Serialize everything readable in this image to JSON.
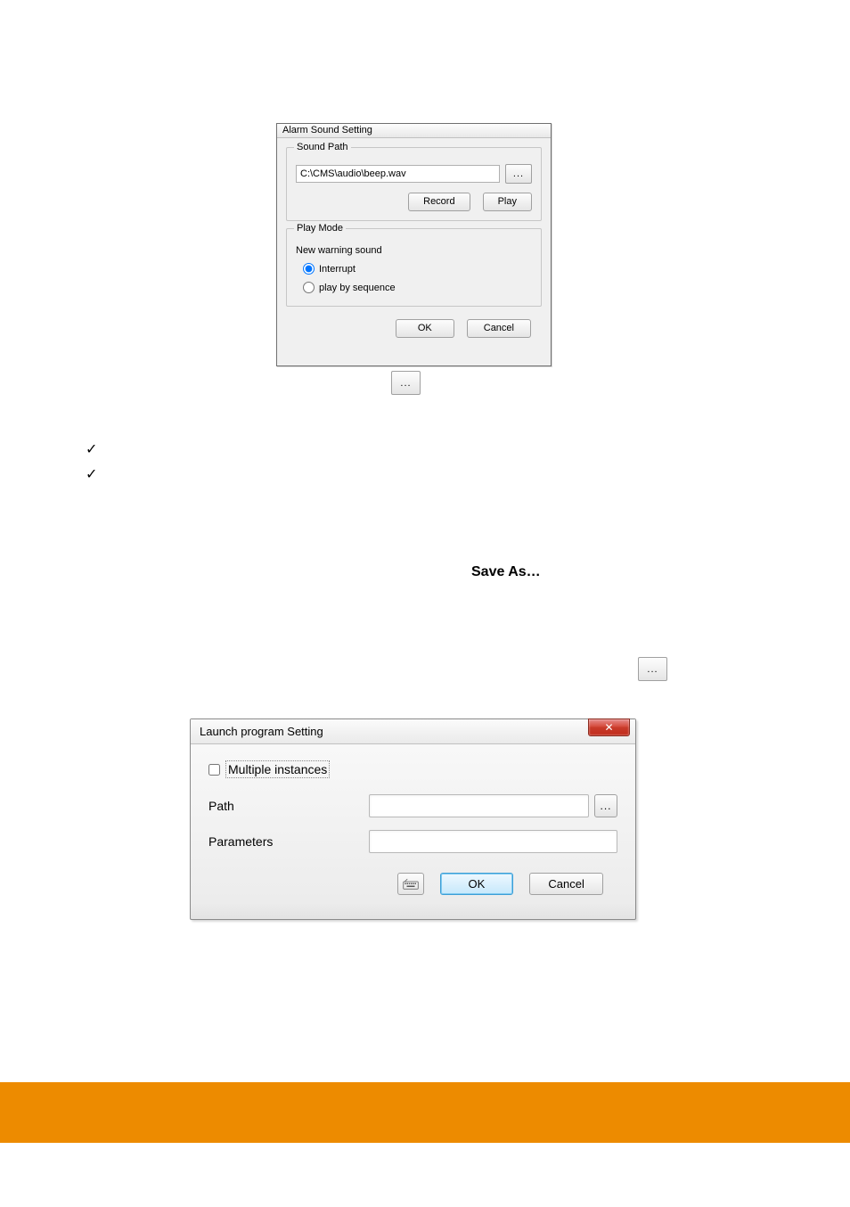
{
  "dialog1": {
    "title": "Alarm Sound Setting",
    "sound_path_group": "Sound Path",
    "path_value": "C:\\CMS\\audio\\beep.wav",
    "browse_label": "...",
    "record_label": "Record",
    "play_label": "Play",
    "play_mode_group": "Play Mode",
    "subhead": "New warning sound",
    "radio_interrupt": "Interrupt",
    "radio_sequence": "play by sequence",
    "ok_label": "OK",
    "cancel_label": "Cancel"
  },
  "inline_browse": "...",
  "checks": {
    "check_glyph": "✓"
  },
  "save_as_text": "Save As…",
  "inline_browse2": "...",
  "dialog2": {
    "title": "Launch program Setting",
    "close_glyph": "✕",
    "multi_label": "Multiple instances",
    "path_label": "Path",
    "path_value": "",
    "path_placeholder": "",
    "browse_label": "...",
    "params_label": "Parameters",
    "params_value": "",
    "params_placeholder": "",
    "ok_label": "OK",
    "cancel_label": "Cancel"
  },
  "colors": {
    "footer": "#ed8b00"
  }
}
